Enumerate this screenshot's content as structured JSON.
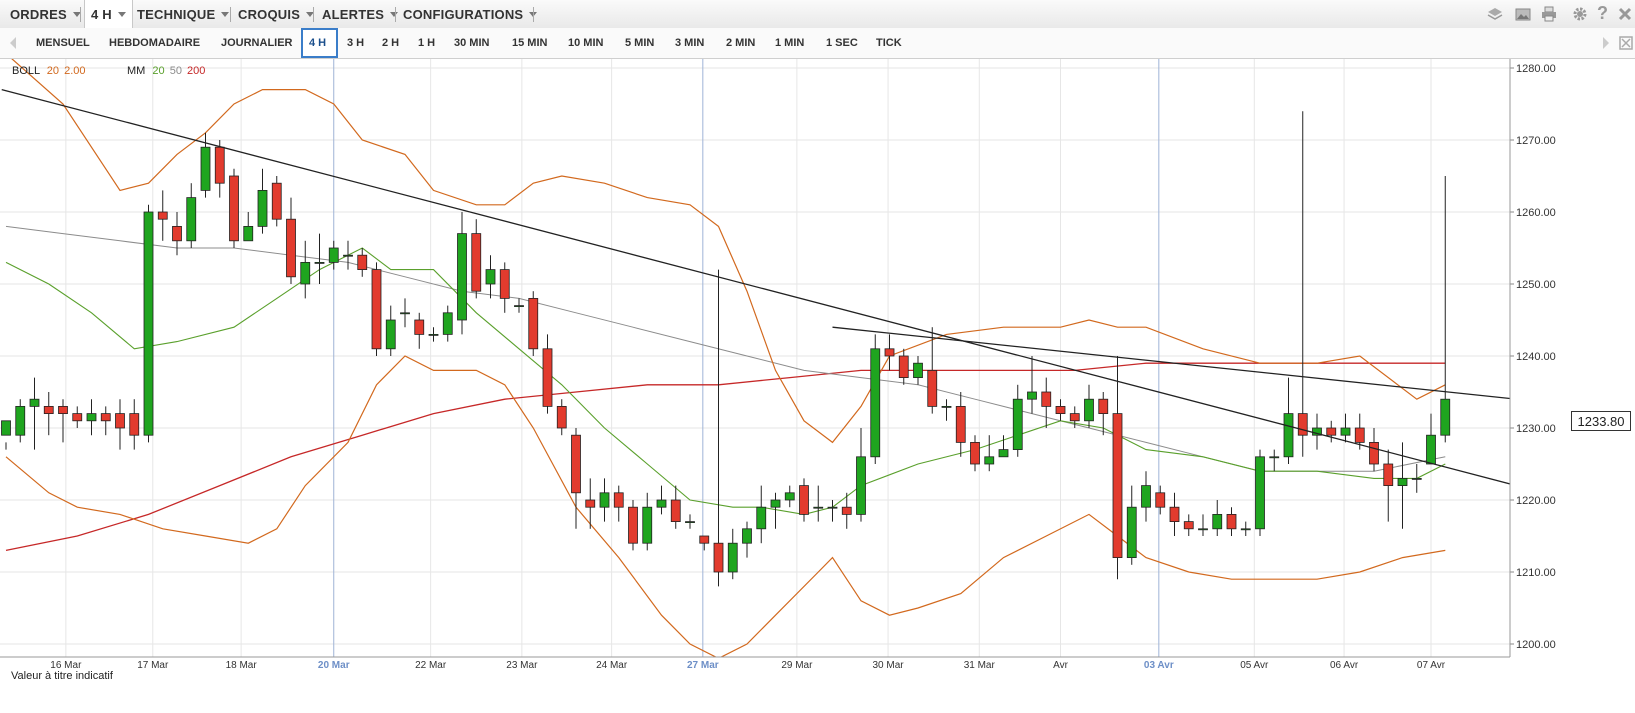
{
  "menu": {
    "items": [
      {
        "label": "ORDRES"
      },
      {
        "label": "4 H"
      },
      {
        "label": "TECHNIQUE"
      },
      {
        "label": "CROQUIS"
      },
      {
        "label": "ALERTES"
      },
      {
        "label": "CONFIGURATIONS"
      }
    ],
    "icons": [
      "layers-icon",
      "image-icon",
      "print-icon",
      "gear-icon",
      "help-icon",
      "close-icon"
    ]
  },
  "timeframes": {
    "items": [
      "MENSUEL",
      "HEBDOMADAIRE",
      "JOURNALIER",
      "4 H",
      "3 H",
      "2 H",
      "1 H",
      "30 MIN",
      "15 MIN",
      "10 MIN",
      "5 MIN",
      "3 MIN",
      "2 MIN",
      "1 MIN",
      "1 SEC",
      "TICK"
    ],
    "selected": "4 H"
  },
  "legend": {
    "boll": {
      "label": "BOLL",
      "p1": "20",
      "p2": "2.00"
    },
    "mm": {
      "label": "MM",
      "p1": "20",
      "p2": "50",
      "p3": "200"
    }
  },
  "current_price": "1233.80",
  "note": "Valeur à titre indicatif",
  "colors": {
    "up": "#1fa51f",
    "down": "#e23b2e",
    "boll": "#d2691e",
    "mm20": "#5aa02c",
    "mm50": "#8c8c8c",
    "mm200": "#c62828"
  },
  "chart_data": {
    "type": "candlestick",
    "ylim": [
      1197,
      1283
    ],
    "y_ticks": [
      "1280.00",
      "1270.00",
      "1260.00",
      "1250.00",
      "1240.00",
      "1230.00",
      "1220.00",
      "1210.00",
      "1200.00"
    ],
    "x_ticks": [
      {
        "label": "16 Mar",
        "i": 4.2,
        "major": false
      },
      {
        "label": "17 Mar",
        "i": 10.3,
        "major": false
      },
      {
        "label": "18 Mar",
        "i": 16.5,
        "major": false
      },
      {
        "label": "20 Mar",
        "i": 23.0,
        "major": true
      },
      {
        "label": "22 Mar",
        "i": 29.8,
        "major": false
      },
      {
        "label": "23 Mar",
        "i": 36.2,
        "major": false
      },
      {
        "label": "24 Mar",
        "i": 42.5,
        "major": false
      },
      {
        "label": "27 Mar",
        "i": 48.9,
        "major": true
      },
      {
        "label": "29 Mar",
        "i": 55.5,
        "major": false
      },
      {
        "label": "30 Mar",
        "i": 61.9,
        "major": false
      },
      {
        "label": "31 Mar",
        "i": 68.3,
        "major": false
      },
      {
        "label": "Avr",
        "i": 74.0,
        "major": false
      },
      {
        "label": "03 Avr",
        "i": 80.9,
        "major": true
      },
      {
        "label": "05 Avr",
        "i": 87.6,
        "major": false
      },
      {
        "label": "06 Avr",
        "i": 93.9,
        "major": false
      },
      {
        "label": "07 Avr",
        "i": 100.0,
        "major": false
      }
    ],
    "candles": [
      [
        1229,
        1231,
        1228,
        1227
      ],
      [
        1229,
        1233,
        1234,
        1228
      ],
      [
        1233,
        1234,
        1237,
        1227
      ],
      [
        1233,
        1232,
        1235,
        1229
      ],
      [
        1233,
        1232,
        1234,
        1228
      ],
      [
        1232,
        1231,
        1233,
        1230
      ],
      [
        1231,
        1232,
        1234,
        1229
      ],
      [
        1232,
        1231,
        1233,
        1229
      ],
      [
        1232,
        1230,
        1234,
        1227
      ],
      [
        1232,
        1229,
        1234,
        1227
      ],
      [
        1229,
        1260,
        1261,
        1228
      ],
      [
        1260,
        1259,
        1263,
        1256
      ],
      [
        1258,
        1256,
        1260,
        1254
      ],
      [
        1256,
        1262,
        1264,
        1255
      ],
      [
        1263,
        1269,
        1271,
        1262
      ],
      [
        1269,
        1264,
        1270,
        1262
      ],
      [
        1265,
        1256,
        1266,
        1255
      ],
      [
        1256,
        1258,
        1260,
        1256
      ],
      [
        1258,
        1263,
        1266,
        1257
      ],
      [
        1264,
        1259,
        1265,
        1258
      ],
      [
        1259,
        1251,
        1262,
        1250
      ],
      [
        1250,
        1253,
        1256,
        1248
      ],
      [
        1253,
        1253,
        1257,
        1250
      ],
      [
        1253,
        1255,
        1256,
        1252
      ],
      [
        1254,
        1254,
        1256,
        1252
      ],
      [
        1254,
        1252,
        1255,
        1251
      ],
      [
        1252,
        1241,
        1253,
        1240
      ],
      [
        1241,
        1245,
        1247,
        1240
      ],
      [
        1246,
        1246,
        1248,
        1244
      ],
      [
        1245,
        1243,
        1246,
        1241
      ],
      [
        1243,
        1243,
        1244,
        1242
      ],
      [
        1243,
        1246,
        1247,
        1242
      ],
      [
        1245,
        1257,
        1260,
        1243
      ],
      [
        1257,
        1249,
        1259,
        1248
      ],
      [
        1250,
        1252,
        1254,
        1248
      ],
      [
        1252,
        1248,
        1253,
        1246
      ],
      [
        1247,
        1247,
        1248,
        1246
      ],
      [
        1248,
        1241,
        1249,
        1240
      ],
      [
        1241,
        1233,
        1243,
        1232
      ],
      [
        1233,
        1230,
        1234,
        1229
      ],
      [
        1229,
        1221,
        1230,
        1216
      ],
      [
        1220,
        1219,
        1223,
        1216
      ],
      [
        1219,
        1221,
        1223,
        1217
      ],
      [
        1221,
        1219,
        1222,
        1217
      ],
      [
        1219,
        1214,
        1220,
        1213
      ],
      [
        1214,
        1219,
        1221,
        1213
      ],
      [
        1219,
        1220,
        1222,
        1218
      ],
      [
        1220,
        1217,
        1222,
        1216
      ],
      [
        1217,
        1217,
        1218,
        1216
      ],
      [
        1215,
        1214,
        1215,
        1213
      ],
      [
        1214,
        1210,
        1252,
        1208
      ],
      [
        1210,
        1214,
        1216,
        1209
      ],
      [
        1214,
        1216,
        1217,
        1212
      ],
      [
        1216,
        1219,
        1222,
        1214
      ],
      [
        1219,
        1220,
        1221,
        1216
      ],
      [
        1220,
        1221,
        1222,
        1219
      ],
      [
        1222,
        1218,
        1223,
        1217
      ],
      [
        1219,
        1219,
        1222,
        1217
      ],
      [
        1219,
        1219,
        1220,
        1217
      ],
      [
        1219,
        1218,
        1221,
        1216
      ],
      [
        1218,
        1226,
        1230,
        1217
      ],
      [
        1226,
        1241,
        1243,
        1225
      ],
      [
        1241,
        1240,
        1243,
        1238
      ],
      [
        1240,
        1237,
        1241,
        1236
      ],
      [
        1237,
        1239,
        1240,
        1236
      ],
      [
        1238,
        1233,
        1244,
        1232
      ],
      [
        1233,
        1233,
        1234,
        1231
      ],
      [
        1233,
        1228,
        1235,
        1226
      ],
      [
        1228,
        1225,
        1229,
        1224
      ],
      [
        1225,
        1226,
        1229,
        1224
      ],
      [
        1226,
        1227,
        1229,
        1226
      ],
      [
        1227,
        1234,
        1236,
        1226
      ],
      [
        1234,
        1235,
        1240,
        1232
      ],
      [
        1235,
        1233,
        1237,
        1230
      ],
      [
        1233,
        1232,
        1234,
        1231
      ],
      [
        1232,
        1231,
        1233,
        1230
      ],
      [
        1231,
        1234,
        1236,
        1230
      ],
      [
        1234,
        1232,
        1235,
        1229
      ],
      [
        1232,
        1212,
        1240,
        1209
      ],
      [
        1212,
        1219,
        1222,
        1211
      ],
      [
        1219,
        1222,
        1224,
        1217
      ],
      [
        1221,
        1219,
        1222,
        1218
      ],
      [
        1219,
        1217,
        1221,
        1215
      ],
      [
        1217,
        1216,
        1218,
        1215
      ],
      [
        1216,
        1216,
        1218,
        1215
      ],
      [
        1216,
        1218,
        1220,
        1215
      ],
      [
        1218,
        1216,
        1219,
        1215
      ],
      [
        1216,
        1216,
        1217,
        1215
      ],
      [
        1216,
        1226,
        1227,
        1215
      ],
      [
        1226,
        1226,
        1227,
        1224
      ],
      [
        1226,
        1232,
        1237,
        1225
      ],
      [
        1232,
        1229,
        1274,
        1226
      ],
      [
        1229,
        1230,
        1232,
        1227
      ],
      [
        1230,
        1229,
        1231,
        1228
      ],
      [
        1229,
        1230,
        1232,
        1228
      ],
      [
        1230,
        1228,
        1232,
        1227
      ],
      [
        1228,
        1225,
        1230,
        1224
      ],
      [
        1225,
        1222,
        1227,
        1217
      ],
      [
        1222,
        1223,
        1228,
        1216
      ],
      [
        1223,
        1223,
        1225,
        1221
      ],
      [
        1225,
        1229,
        1232,
        1225
      ],
      [
        1229,
        1234,
        1265,
        1228
      ]
    ],
    "bollinger": {
      "upper": [
        [
          0,
          1282
        ],
        [
          4,
          1275
        ],
        [
          8,
          1263
        ],
        [
          10,
          1264
        ],
        [
          12,
          1268
        ],
        [
          14,
          1271
        ],
        [
          16,
          1275
        ],
        [
          18,
          1277
        ],
        [
          21,
          1277
        ],
        [
          23,
          1275
        ],
        [
          25,
          1270
        ],
        [
          28,
          1268
        ],
        [
          30,
          1263
        ],
        [
          33,
          1261
        ],
        [
          35,
          1261
        ],
        [
          37,
          1264
        ],
        [
          39,
          1265
        ],
        [
          42,
          1264
        ],
        [
          45,
          1262
        ],
        [
          48,
          1261
        ],
        [
          50,
          1258
        ],
        [
          52,
          1249
        ],
        [
          54,
          1238
        ],
        [
          56,
          1231
        ],
        [
          58,
          1228
        ],
        [
          60,
          1233
        ],
        [
          62,
          1240
        ],
        [
          66,
          1243
        ],
        [
          70,
          1244
        ],
        [
          74,
          1244
        ],
        [
          76,
          1245
        ],
        [
          78,
          1244
        ],
        [
          80,
          1244
        ],
        [
          84,
          1241
        ],
        [
          88,
          1239
        ],
        [
          92,
          1239
        ],
        [
          95,
          1240
        ],
        [
          99,
          1234
        ],
        [
          101,
          1236
        ]
      ],
      "middle": [
        [
          0,
          1253
        ],
        [
          3,
          1250
        ],
        [
          6,
          1246
        ],
        [
          9,
          1241
        ],
        [
          12,
          1242
        ],
        [
          16,
          1244
        ],
        [
          19,
          1248
        ],
        [
          22,
          1252
        ],
        [
          25,
          1255
        ],
        [
          27,
          1252
        ],
        [
          30,
          1252
        ],
        [
          33,
          1246
        ],
        [
          36,
          1241
        ],
        [
          39,
          1236
        ],
        [
          42,
          1230
        ],
        [
          45,
          1225
        ],
        [
          48,
          1220
        ],
        [
          51,
          1219
        ],
        [
          53,
          1219
        ],
        [
          56,
          1218
        ],
        [
          58,
          1219
        ],
        [
          60,
          1222
        ],
        [
          64,
          1225
        ],
        [
          68,
          1227
        ],
        [
          71,
          1229
        ],
        [
          74,
          1231
        ],
        [
          77,
          1230
        ],
        [
          80,
          1227
        ],
        [
          84,
          1226
        ],
        [
          88,
          1224
        ],
        [
          92,
          1224
        ],
        [
          96,
          1223
        ],
        [
          99,
          1223
        ],
        [
          101,
          1225
        ]
      ],
      "lower": [
        [
          0,
          1226
        ],
        [
          3,
          1221
        ],
        [
          5,
          1219
        ],
        [
          8,
          1218
        ],
        [
          11,
          1216
        ],
        [
          14,
          1215
        ],
        [
          17,
          1214
        ],
        [
          19,
          1216
        ],
        [
          21,
          1222
        ],
        [
          24,
          1228
        ],
        [
          26,
          1236
        ],
        [
          28,
          1240
        ],
        [
          30,
          1238
        ],
        [
          33,
          1238
        ],
        [
          35,
          1236
        ],
        [
          37,
          1230
        ],
        [
          40,
          1219
        ],
        [
          43,
          1212
        ],
        [
          46,
          1204
        ],
        [
          48,
          1200
        ],
        [
          50,
          1198
        ],
        [
          52,
          1200
        ],
        [
          54,
          1204
        ],
        [
          57,
          1210
        ],
        [
          58,
          1212
        ],
        [
          60,
          1206
        ],
        [
          62,
          1204
        ],
        [
          64,
          1205
        ],
        [
          67,
          1207
        ],
        [
          70,
          1212
        ],
        [
          73,
          1215
        ],
        [
          76,
          1218
        ],
        [
          78,
          1215
        ],
        [
          80,
          1212
        ],
        [
          83,
          1210
        ],
        [
          86,
          1209
        ],
        [
          89,
          1209
        ],
        [
          92,
          1209
        ],
        [
          95,
          1210
        ],
        [
          98,
          1212
        ],
        [
          101,
          1213
        ]
      ]
    },
    "mm50": [
      [
        0,
        1258
      ],
      [
        4,
        1257
      ],
      [
        8,
        1256
      ],
      [
        12,
        1255
      ],
      [
        16,
        1255
      ],
      [
        20,
        1254
      ],
      [
        24,
        1253
      ],
      [
        28,
        1251
      ],
      [
        32,
        1249
      ],
      [
        36,
        1248
      ],
      [
        40,
        1246
      ],
      [
        44,
        1244
      ],
      [
        48,
        1242
      ],
      [
        52,
        1240
      ],
      [
        56,
        1238
      ],
      [
        60,
        1237
      ],
      [
        64,
        1236
      ],
      [
        68,
        1234
      ],
      [
        72,
        1232
      ],
      [
        76,
        1230
      ],
      [
        80,
        1228
      ],
      [
        84,
        1226
      ],
      [
        88,
        1224
      ],
      [
        92,
        1224
      ],
      [
        96,
        1224
      ],
      [
        101,
        1226
      ]
    ],
    "mm200": [
      [
        0,
        1213
      ],
      [
        5,
        1215
      ],
      [
        10,
        1218
      ],
      [
        15,
        1222
      ],
      [
        20,
        1226
      ],
      [
        25,
        1229
      ],
      [
        30,
        1232
      ],
      [
        35,
        1234
      ],
      [
        40,
        1235
      ],
      [
        45,
        1236
      ],
      [
        50,
        1236
      ],
      [
        55,
        1237
      ],
      [
        60,
        1238
      ],
      [
        65,
        1238
      ],
      [
        70,
        1238
      ],
      [
        75,
        1238
      ],
      [
        80,
        1239
      ],
      [
        85,
        1239
      ],
      [
        90,
        1239
      ],
      [
        95,
        1239
      ],
      [
        101,
        1239
      ]
    ],
    "trendlines": [
      {
        "from": [
          -0.3,
          1277
        ],
        "to": [
          106,
          1222
        ]
      },
      {
        "from": [
          58,
          1244
        ],
        "to": [
          106,
          1234
        ]
      }
    ]
  }
}
